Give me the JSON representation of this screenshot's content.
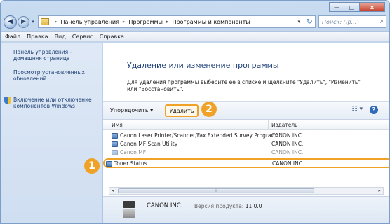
{
  "window": {
    "minimize_glyph": "—",
    "maximize_glyph": "□",
    "close_glyph": "x"
  },
  "address_bar": {
    "back_glyph": "◀",
    "forward_glyph": "▶",
    "crumbs": [
      "Панель управления",
      "Программы",
      "Программы и компоненты"
    ],
    "separator": "▸",
    "dropdown_glyph": "▾",
    "refresh_glyph": "↻"
  },
  "search": {
    "placeholder": "Поиск: Пр...",
    "icon": "search-icon"
  },
  "menu": [
    "Файл",
    "Правка",
    "Вид",
    "Сервис",
    "Справка"
  ],
  "left_pane": {
    "links": [
      "Панель управления - домашняя страница",
      "Просмотр установленных обновлений",
      "Включение или отключение компонентов Windows"
    ]
  },
  "main": {
    "title": "Удаление или изменение программы",
    "description": "Для удаления программы выберите ее в списке и щелкните \"Удалить\", \"Изменить\" или \"Восстановить\"."
  },
  "toolbar": {
    "organize_label": "Упорядочить ▾",
    "uninstall_label": "Удалить",
    "views_glyph": "☷ ▾",
    "help_glyph": "?"
  },
  "badges": {
    "step1": "1",
    "step2": "2"
  },
  "table": {
    "columns": {
      "name": "Имя",
      "publisher": "Издатель"
    },
    "rows": [
      {
        "name": "Canon Laser Printer/Scanner/Fax Extended Survey Program",
        "publisher": "CANON INC."
      },
      {
        "name": "Canon MF Scan Utility",
        "publisher": "CANON INC."
      },
      {
        "name": "Canon MF",
        "publisher": "CANON INC."
      }
    ],
    "selected_row": {
      "name": "Toner Status",
      "publisher": "CANON INC."
    }
  },
  "scrollbar": {
    "left_glyph": "◂",
    "right_glyph": "▸",
    "thumb_glyph": "III"
  },
  "details": {
    "publisher": "CANON INC.",
    "version_label": "Версия продукта:",
    "version_value": "11.0.0"
  }
}
